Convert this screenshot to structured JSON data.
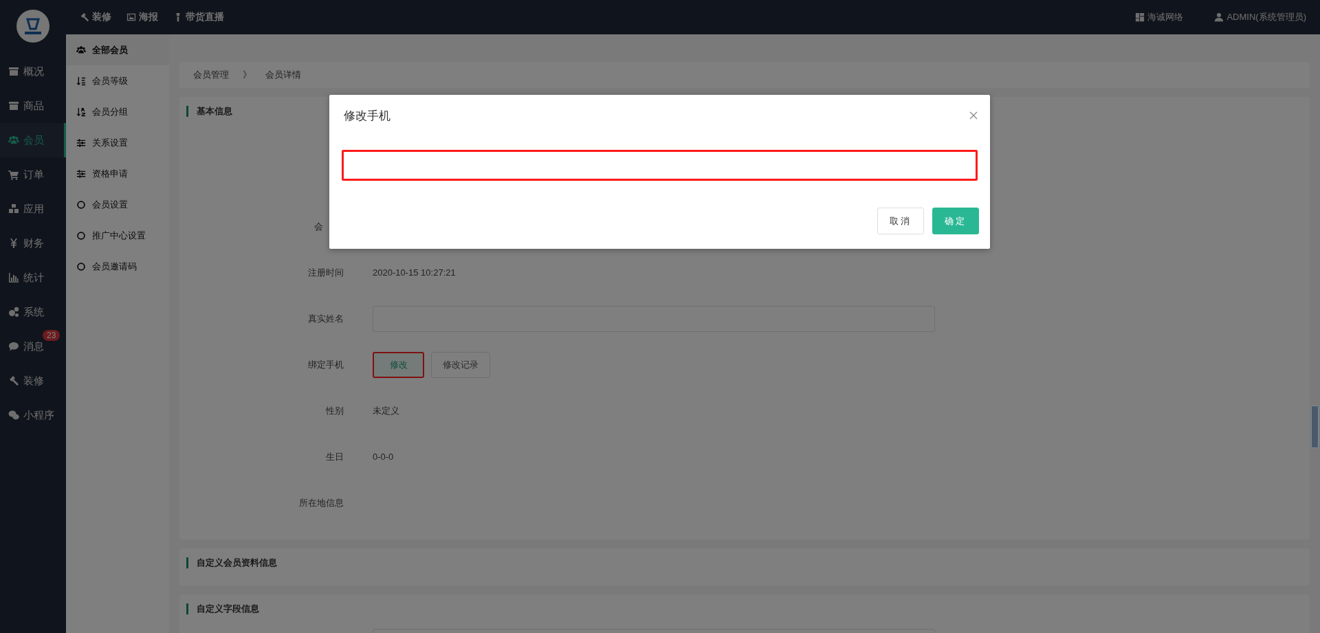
{
  "top_nav": {
    "items": [
      {
        "label": "装修"
      },
      {
        "label": "海报"
      },
      {
        "label": "带货直播"
      }
    ],
    "right": [
      {
        "label": "海诚网络"
      },
      {
        "label": "ADMIN(系统管理员)"
      }
    ]
  },
  "sidebar": {
    "items": [
      {
        "label": "概况",
        "selected": false
      },
      {
        "label": "商品",
        "selected": false
      },
      {
        "label": "会员",
        "selected": true
      },
      {
        "label": "订单",
        "selected": false
      },
      {
        "label": "应用",
        "selected": false
      },
      {
        "label": "财务",
        "selected": false
      },
      {
        "label": "统计",
        "selected": false
      },
      {
        "label": "系统",
        "selected": false
      },
      {
        "label": "消息",
        "selected": false,
        "badge": "23"
      },
      {
        "label": "装修",
        "selected": false
      },
      {
        "label": "小程序",
        "selected": false
      }
    ]
  },
  "submenu": {
    "items": [
      {
        "label": "全部会员",
        "selected": true
      },
      {
        "label": "会员等级",
        "selected": false
      },
      {
        "label": "会员分组",
        "selected": false
      },
      {
        "label": "关系设置",
        "selected": false
      },
      {
        "label": "资格申请",
        "selected": false
      },
      {
        "label": "会员设置",
        "selected": false
      },
      {
        "label": "推广中心设置",
        "selected": false
      },
      {
        "label": "会员邀请码",
        "selected": false
      }
    ]
  },
  "breadcrumb": [
    "会员管理",
    "》",
    "会员详情"
  ],
  "basic_info": {
    "title": "基本信息",
    "rows": [
      {
        "kind": "partial",
        "label": "会"
      },
      {
        "kind": "text",
        "label": "注册时间",
        "value": "2020-10-15 10:27:21"
      },
      {
        "kind": "input",
        "label": "真实姓名"
      },
      {
        "kind": "buttons",
        "label": "绑定手机",
        "buttons": [
          {
            "label": "修改",
            "highlighted": true
          },
          {
            "label": "修改记录",
            "highlighted": false
          }
        ]
      },
      {
        "kind": "text",
        "label": "性别",
        "value": "未定义"
      },
      {
        "kind": "text",
        "label": "生日",
        "value": "0-0-0"
      },
      {
        "kind": "text",
        "label": "所在地信息"
      }
    ]
  },
  "sections": [
    {
      "title": "自定义会员资料信息",
      "has_input": false
    },
    {
      "title": "自定义字段信息",
      "has_input": true
    }
  ],
  "modal": {
    "title": "修改手机",
    "input": {
      "highlighted": true
    },
    "buttons": [
      {
        "kind": "default",
        "label": "取消"
      },
      {
        "kind": "primary",
        "label": "确定"
      }
    ]
  }
}
